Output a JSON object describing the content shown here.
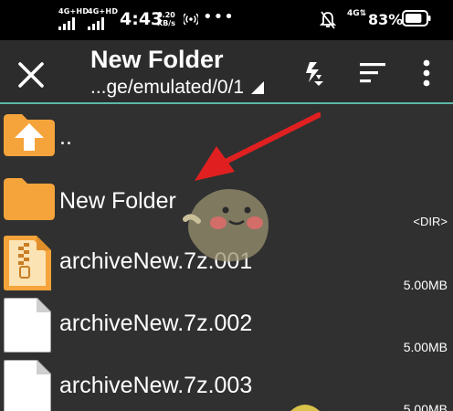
{
  "status_bar": {
    "sim1_network": "4G+HD",
    "sim2_network": "4G+HD",
    "time": "4:43",
    "speed_value": "0.20",
    "speed_unit": "KB/s",
    "more_dots": "•••",
    "mobile_data": "4G",
    "battery_percent": "83%",
    "battery_level": 0.83
  },
  "toolbar": {
    "title": "New Folder",
    "path": "...ge/emulated/0/1",
    "icons": [
      "close-icon",
      "compress-icon",
      "sort-icon",
      "more-vert-icon"
    ]
  },
  "file_list": {
    "items": [
      {
        "name": "..",
        "meta": "",
        "icon": "folder-up-icon"
      },
      {
        "name": "New Folder",
        "meta": "<DIR>",
        "icon": "folder-icon"
      },
      {
        "name": "archiveNew.7z.001",
        "meta": "5.00MB",
        "icon": "archive-file-icon"
      },
      {
        "name": "archiveNew.7z.002",
        "meta": "5.00MB",
        "icon": "file-icon"
      },
      {
        "name": "archiveNew.7z.003",
        "meta": "5.00MB",
        "icon": "file-icon"
      }
    ]
  },
  "colors": {
    "status_bar_bg": "#000000",
    "toolbar_bg": "#2c2c2c",
    "list_bg": "#303030",
    "accent": "#5cb8a8",
    "folder": "#f5a43b",
    "annotation_arrow": "#e02020"
  }
}
